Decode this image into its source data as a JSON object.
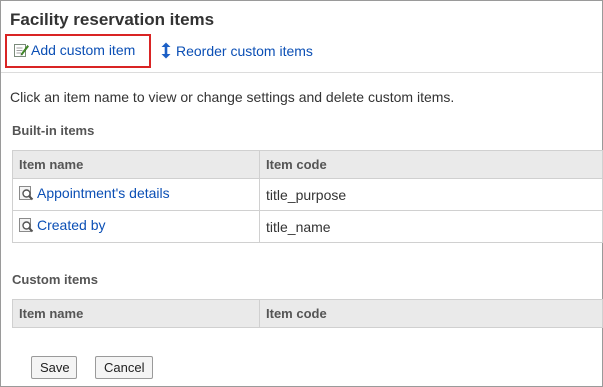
{
  "page": {
    "title": "Facility reservation items"
  },
  "toolbar": {
    "add_label": "Add custom item",
    "add_icon": "add-item-icon",
    "reorder_label": "Reorder custom items",
    "reorder_icon": "up-down-arrow-icon"
  },
  "description": "Click an item name to view or change settings and delete custom items.",
  "builtin": {
    "heading": "Built-in items",
    "columns": [
      "Item name",
      "Item code"
    ],
    "rows": [
      {
        "name": "Appointment's details",
        "code": "title_purpose",
        "icon": "details-magnifier-icon"
      },
      {
        "name": "Created by",
        "code": "title_name",
        "icon": "details-magnifier-icon"
      }
    ]
  },
  "custom": {
    "heading": "Custom items",
    "columns": [
      "Item name",
      "Item code"
    ],
    "rows": []
  },
  "buttons": {
    "save": "Save",
    "cancel": "Cancel"
  },
  "colors": {
    "link": "#0b4fb5",
    "highlight": "#d92424",
    "header_bg": "#eaeaea"
  }
}
